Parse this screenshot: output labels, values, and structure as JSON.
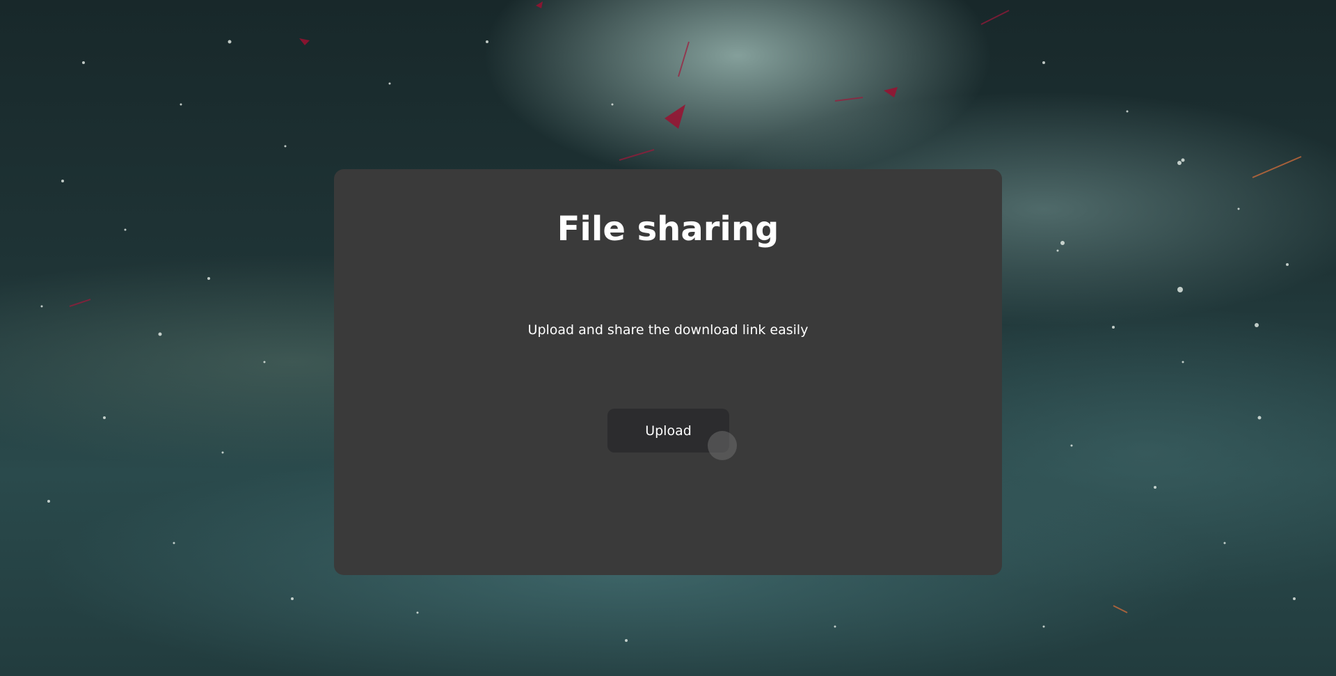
{
  "page": {
    "title": "File sharing",
    "subtitle": "Upload and share the download link easily"
  },
  "actions": {
    "upload_label": "Upload"
  },
  "colors": {
    "card_background": "#3a3a3a",
    "button_background": "#2c2c2e",
    "text": "#ffffff"
  }
}
